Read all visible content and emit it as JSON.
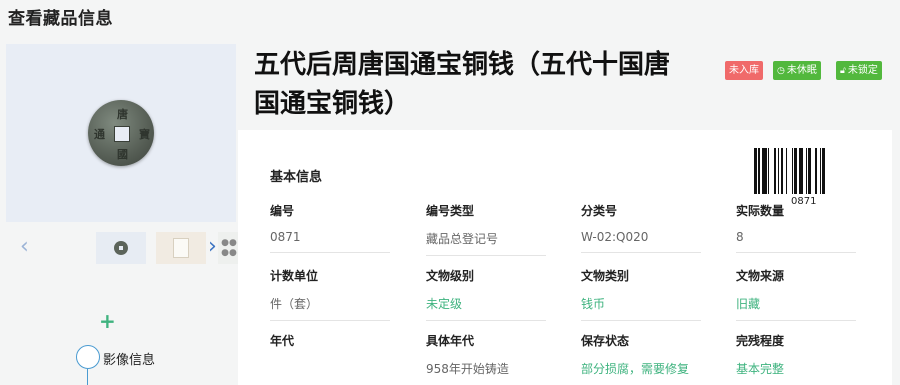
{
  "page": {
    "title": "查看藏品信息"
  },
  "relic": {
    "name": "五代后周唐国通宝铜钱（五代十国唐国通宝铜钱）",
    "badges": [
      {
        "label": "未入库",
        "icon": ""
      },
      {
        "label": "未休眠",
        "icon": "clock-icon"
      },
      {
        "label": "未锁定",
        "icon": "lock-icon"
      }
    ]
  },
  "gallery": {
    "prev": "‹",
    "next": "›"
  },
  "sidebar": {
    "plus": "+",
    "image_info": "影像信息"
  },
  "basic_info": {
    "title": "基本信息",
    "barcode_number": "0871",
    "fields": [
      {
        "label": "编号",
        "value": "0871"
      },
      {
        "label": "编号类型",
        "value": "藏品总登记号"
      },
      {
        "label": "分类号",
        "value": "W-02:Q020"
      },
      {
        "label": "实际数量",
        "value": "8"
      },
      {
        "label": "计数单位",
        "value": "件（套）"
      },
      {
        "label": "文物级别",
        "value": "未定级"
      },
      {
        "label": "文物类别",
        "value": "钱币"
      },
      {
        "label": "文物来源",
        "value": "旧藏"
      },
      {
        "label": "年代",
        "value": ""
      },
      {
        "label": "具体年代",
        "value": "958年开始铸造"
      },
      {
        "label": "保存状态",
        "value": "部分损腐，需要修复"
      },
      {
        "label": "完残程度",
        "value": "基本完整"
      }
    ]
  },
  "colors": {
    "accent_green": "#3fb37f",
    "badge_red": "#f06a6a",
    "badge_green": "#52b83d"
  }
}
